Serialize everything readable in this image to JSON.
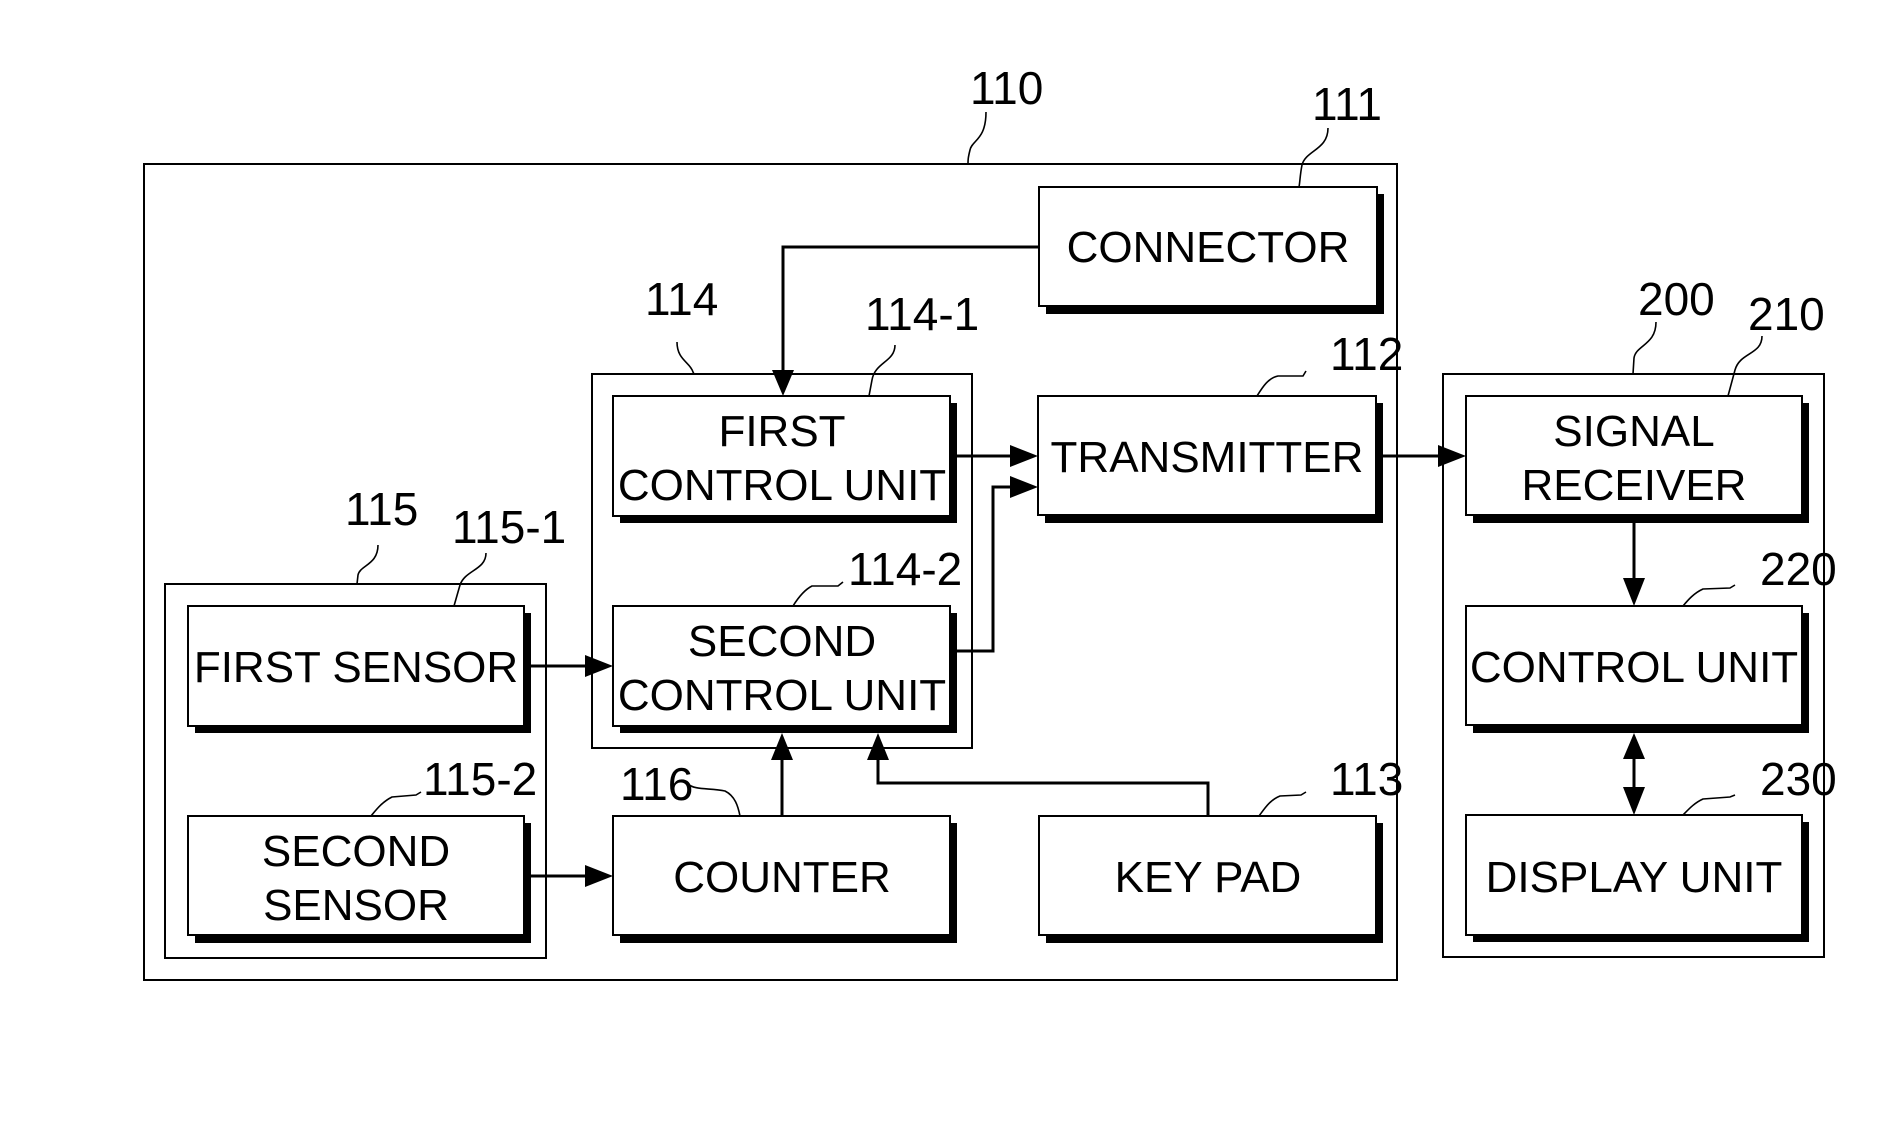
{
  "figure": {
    "groups": {
      "device": {
        "ref": "110"
      },
      "control_group": {
        "ref": "114"
      },
      "sensor_group": {
        "ref": "115"
      },
      "receiver_device": {
        "ref": "200"
      }
    },
    "blocks": {
      "connector": {
        "ref": "111",
        "lines": [
          "CONNECTOR"
        ]
      },
      "transmitter": {
        "ref": "112",
        "lines": [
          "TRANSMITTER"
        ]
      },
      "key_pad": {
        "ref": "113",
        "lines": [
          "KEY PAD"
        ]
      },
      "first_control_unit": {
        "ref": "114-1",
        "lines": [
          "FIRST",
          "CONTROL UNIT"
        ]
      },
      "second_control_unit": {
        "ref": "114-2",
        "lines": [
          "SECOND",
          "CONTROL UNIT"
        ]
      },
      "first_sensor": {
        "ref": "115-1",
        "lines": [
          "FIRST SENSOR"
        ]
      },
      "second_sensor": {
        "ref": "115-2",
        "lines": [
          "SECOND",
          "SENSOR"
        ]
      },
      "counter": {
        "ref": "116",
        "lines": [
          "COUNTER"
        ]
      },
      "signal_receiver": {
        "ref": "210",
        "lines": [
          "SIGNAL",
          "RECEIVER"
        ]
      },
      "control_unit": {
        "ref": "220",
        "lines": [
          "CONTROL UNIT"
        ]
      },
      "display_unit": {
        "ref": "230",
        "lines": [
          "DISPLAY UNIT"
        ]
      }
    },
    "connections": [
      {
        "from": "connector",
        "to": "first_control_unit",
        "type": "arrow"
      },
      {
        "from": "first_control_unit",
        "to": "transmitter",
        "type": "arrow"
      },
      {
        "from": "second_control_unit",
        "to": "transmitter",
        "type": "arrow"
      },
      {
        "from": "first_sensor",
        "to": "second_control_unit",
        "type": "arrow"
      },
      {
        "from": "second_sensor",
        "to": "counter",
        "type": "arrow"
      },
      {
        "from": "counter",
        "to": "second_control_unit",
        "type": "arrow"
      },
      {
        "from": "key_pad",
        "to": "second_control_unit",
        "type": "arrow"
      },
      {
        "from": "transmitter",
        "to": "signal_receiver",
        "type": "arrow"
      },
      {
        "from": "signal_receiver",
        "to": "control_unit",
        "type": "arrow"
      },
      {
        "from": "control_unit",
        "to": "display_unit",
        "type": "bidirectional"
      }
    ]
  }
}
